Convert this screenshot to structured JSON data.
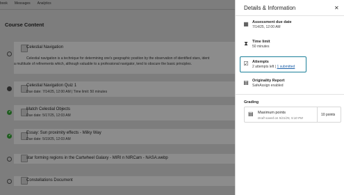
{
  "topnav": {
    "items": [
      "book",
      "Messages",
      "Analytics"
    ]
  },
  "course": {
    "title": "Course Content",
    "items": [
      {
        "title": "Celestial Navigation",
        "description_line1": "Celestial navigation is a technique for determining one's geographic position by the observation of identified stars, ident",
        "description_line2": "a multitude of refinements which, although valuable to a professional navigator, tend to obscure the basic principles.",
        "status": "empty"
      },
      {
        "title": "Celestial Navigation Quiz 1",
        "due": "Due date: 7/14/25, 12:00 AM  |  Time limit: 50 minutes",
        "status": "progress"
      },
      {
        "title": "Match Celestial Objects",
        "due": "Due date: 5/17/25, 12:03 AM",
        "status": "done"
      },
      {
        "title": "Essay: Sun proximity effects - Milky Way",
        "due": "Due date: 5/19/25, 12:03 AM",
        "status": "done"
      },
      {
        "title": "star forming regions in the Cartwheel Galaxy - MIRI n NIRCam - NASA.webp",
        "due": "",
        "status": "empty"
      },
      {
        "title": "Constellations Document",
        "due": "",
        "status": "empty"
      }
    ]
  },
  "panel": {
    "title": "Details & Information",
    "close_glyph": "✕",
    "due": {
      "label": "Assessment due date",
      "value": "7/14/25, 12:00 AM",
      "icon": "calendar-icon"
    },
    "time": {
      "label": "Time limit",
      "value": "50 minutes",
      "icon": "hourglass-icon"
    },
    "attempts": {
      "label": "Attempts",
      "value_prefix": "2 attempts left  |  ",
      "value_link": "1 submitted",
      "icon": "checkbox-icon"
    },
    "originality": {
      "label": "Originality Report",
      "value": "SafeAssign enabled",
      "icon": "document-icon"
    },
    "grading": {
      "title": "Grading",
      "max_label": "Maximum points",
      "max_sub": "Draft saved on 5/21/25, 5:10 PM",
      "max_value": "10 points"
    }
  }
}
